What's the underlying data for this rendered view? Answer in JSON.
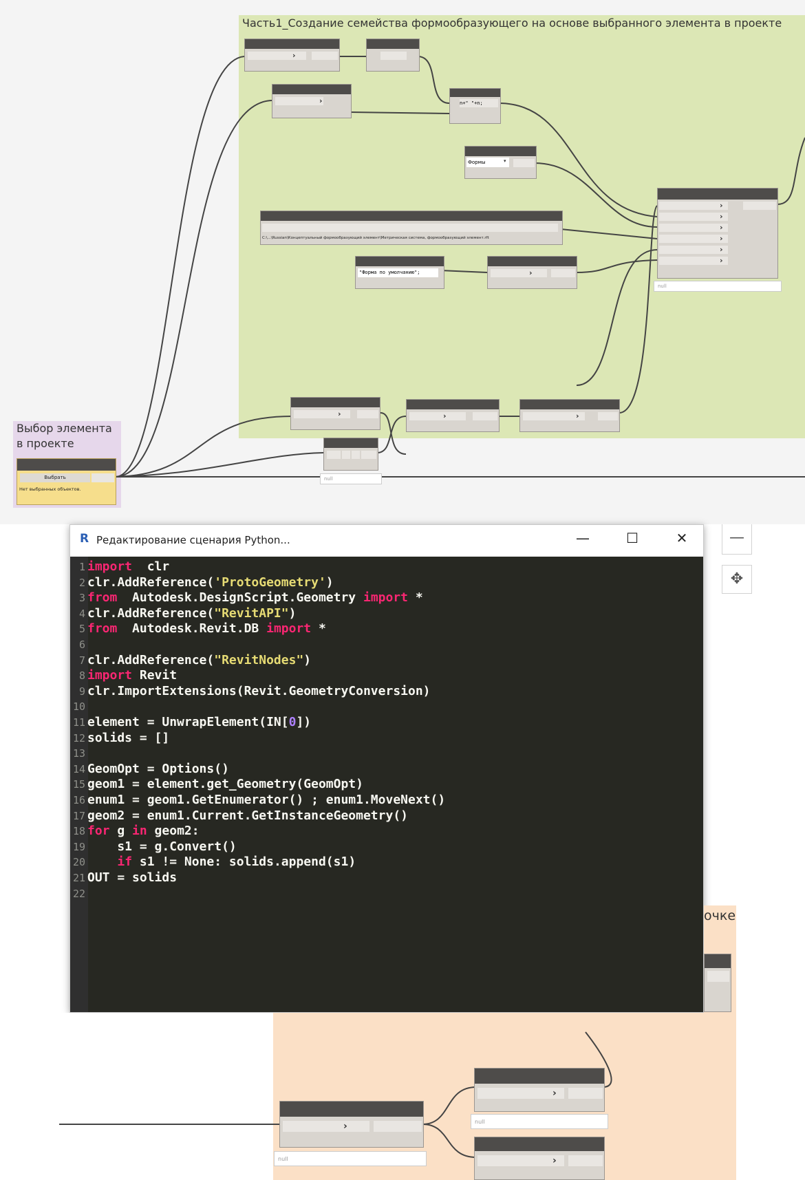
{
  "groups": {
    "part1_title": "Часть1_Создание семейства формообразующего на основе выбранного элемента в проекте",
    "select_title": "Выбор элемента\nв проекте",
    "point_title_fragment": "очке"
  },
  "nodes": {
    "code_block_text": "n+\" \"+n;",
    "dropdown_value": "Формы",
    "file_path": "C:\\...\\Russian\\Концептуальный формообразующий элемент\\Метрическая система, формообразующий элемент.rft",
    "string_value": "\"Форма по умолчанию\";",
    "select_button_label": "Выбрать",
    "select_status": "Нет выбранных объектов.",
    "null_label": "null"
  },
  "editor": {
    "title": "Редактирование сценария Python...",
    "minimize": "—",
    "maximize": "☐",
    "close": "✕"
  },
  "zoom": {
    "zoom_out": "—",
    "pan": "✥"
  },
  "code_lines": [
    {
      "n": "1",
      "parts": [
        [
          "kw",
          "import"
        ],
        [
          "",
          "  clr"
        ]
      ]
    },
    {
      "n": "2",
      "parts": [
        [
          "",
          "clr.AddReference("
        ],
        [
          "str",
          "'ProtoGeometry'"
        ],
        [
          "",
          ")"
        ]
      ]
    },
    {
      "n": "3",
      "parts": [
        [
          "kw",
          "from"
        ],
        [
          "",
          "  Autodesk.DesignScript.Geometry "
        ],
        [
          "kw",
          "import"
        ],
        [
          "",
          " *"
        ]
      ]
    },
    {
      "n": "4",
      "parts": [
        [
          "",
          "clr.AddReference("
        ],
        [
          "str",
          "\"RevitAPI\""
        ],
        [
          "",
          ")"
        ]
      ]
    },
    {
      "n": "5",
      "parts": [
        [
          "kw",
          "from"
        ],
        [
          "",
          "  Autodesk.Revit.DB "
        ],
        [
          "kw",
          "import"
        ],
        [
          "",
          " *"
        ]
      ]
    },
    {
      "n": "6",
      "parts": []
    },
    {
      "n": "7",
      "parts": [
        [
          "",
          "clr.AddReference("
        ],
        [
          "str",
          "\"RevitNodes\""
        ],
        [
          "",
          ")"
        ]
      ]
    },
    {
      "n": "8",
      "parts": [
        [
          "kw",
          "import"
        ],
        [
          "",
          " Revit"
        ]
      ]
    },
    {
      "n": "9",
      "parts": [
        [
          "",
          "clr.ImportExtensions(Revit.GeometryConversion)"
        ]
      ]
    },
    {
      "n": "10",
      "parts": []
    },
    {
      "n": "11",
      "parts": [
        [
          "",
          "element = UnwrapElement(IN["
        ],
        [
          "num",
          "0"
        ],
        [
          "",
          "])"
        ]
      ]
    },
    {
      "n": "12",
      "parts": [
        [
          "",
          "solids = []"
        ]
      ]
    },
    {
      "n": "13",
      "parts": []
    },
    {
      "n": "14",
      "parts": [
        [
          "",
          "GeomOpt = Options()"
        ]
      ]
    },
    {
      "n": "15",
      "parts": [
        [
          "",
          "geom1 = element.get_Geometry(GeomOpt)"
        ]
      ]
    },
    {
      "n": "16",
      "parts": [
        [
          "",
          "enum1 = geom1.GetEnumerator() ; enum1.MoveNext()"
        ]
      ]
    },
    {
      "n": "17",
      "parts": [
        [
          "",
          "geom2 = enum1.Current.GetInstanceGeometry()"
        ]
      ]
    },
    {
      "n": "18",
      "parts": [
        [
          "kw",
          "for"
        ],
        [
          "",
          " g "
        ],
        [
          "kw",
          "in"
        ],
        [
          "",
          " geom2:"
        ]
      ]
    },
    {
      "n": "19",
      "parts": [
        [
          "",
          "    s1 = g.Convert()"
        ]
      ]
    },
    {
      "n": "20",
      "parts": [
        [
          "",
          "    "
        ],
        [
          "kw",
          "if"
        ],
        [
          "",
          " s1 != None: solids.append(s1)"
        ]
      ]
    },
    {
      "n": "21",
      "parts": [
        [
          "",
          "OUT = solids"
        ]
      ]
    },
    {
      "n": "22",
      "parts": []
    }
  ],
  "colors": {
    "part1_group": "#dce7b5",
    "select_group": "#e6d7eb",
    "point_group": "#fbe0c6",
    "node_header": "#4e4c4a",
    "code_bg": "#272822"
  }
}
